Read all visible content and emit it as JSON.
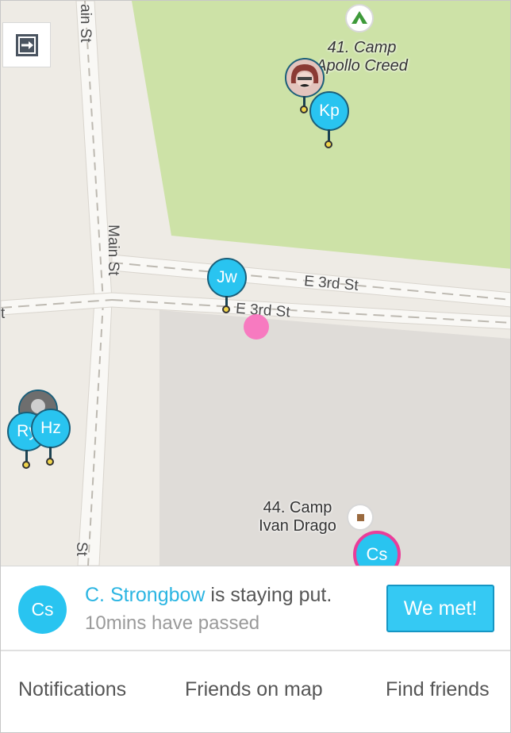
{
  "map": {
    "streets": {
      "main_st_top": "ain St",
      "main_st_mid": "Main St",
      "main_st_bottom": "St",
      "e3rd_upper": "E 3rd St",
      "e3rd_lower": "E 3rd St",
      "left_edge": "t"
    },
    "pois": {
      "camp_apollo": {
        "line1": "41. Camp",
        "line2": "Apollo Creed",
        "icon": "tent-icon"
      },
      "camp_drago": {
        "line1": "44. Camp",
        "line2": "Ivan Drago",
        "icon": "square-icon"
      }
    },
    "pins": {
      "kp": "Kp",
      "jw": "Jw",
      "ry": "Ry",
      "hz": "Hz",
      "cs": "Cs"
    },
    "colors": {
      "park": "#cde2a7",
      "block": "#dfdcd8",
      "pin": "#29c4f0",
      "me": "#f77ac0",
      "selected_ring": "#ea3d99"
    }
  },
  "status": {
    "avatar": "Cs",
    "name": "C. Strongbow",
    "message": " is staying put.",
    "elapsed": "10mins have passed",
    "button": "We met!"
  },
  "tabs": {
    "notifications": "Notifications",
    "friends_on_map": "Friends on map",
    "find_friends": "Find friends"
  }
}
